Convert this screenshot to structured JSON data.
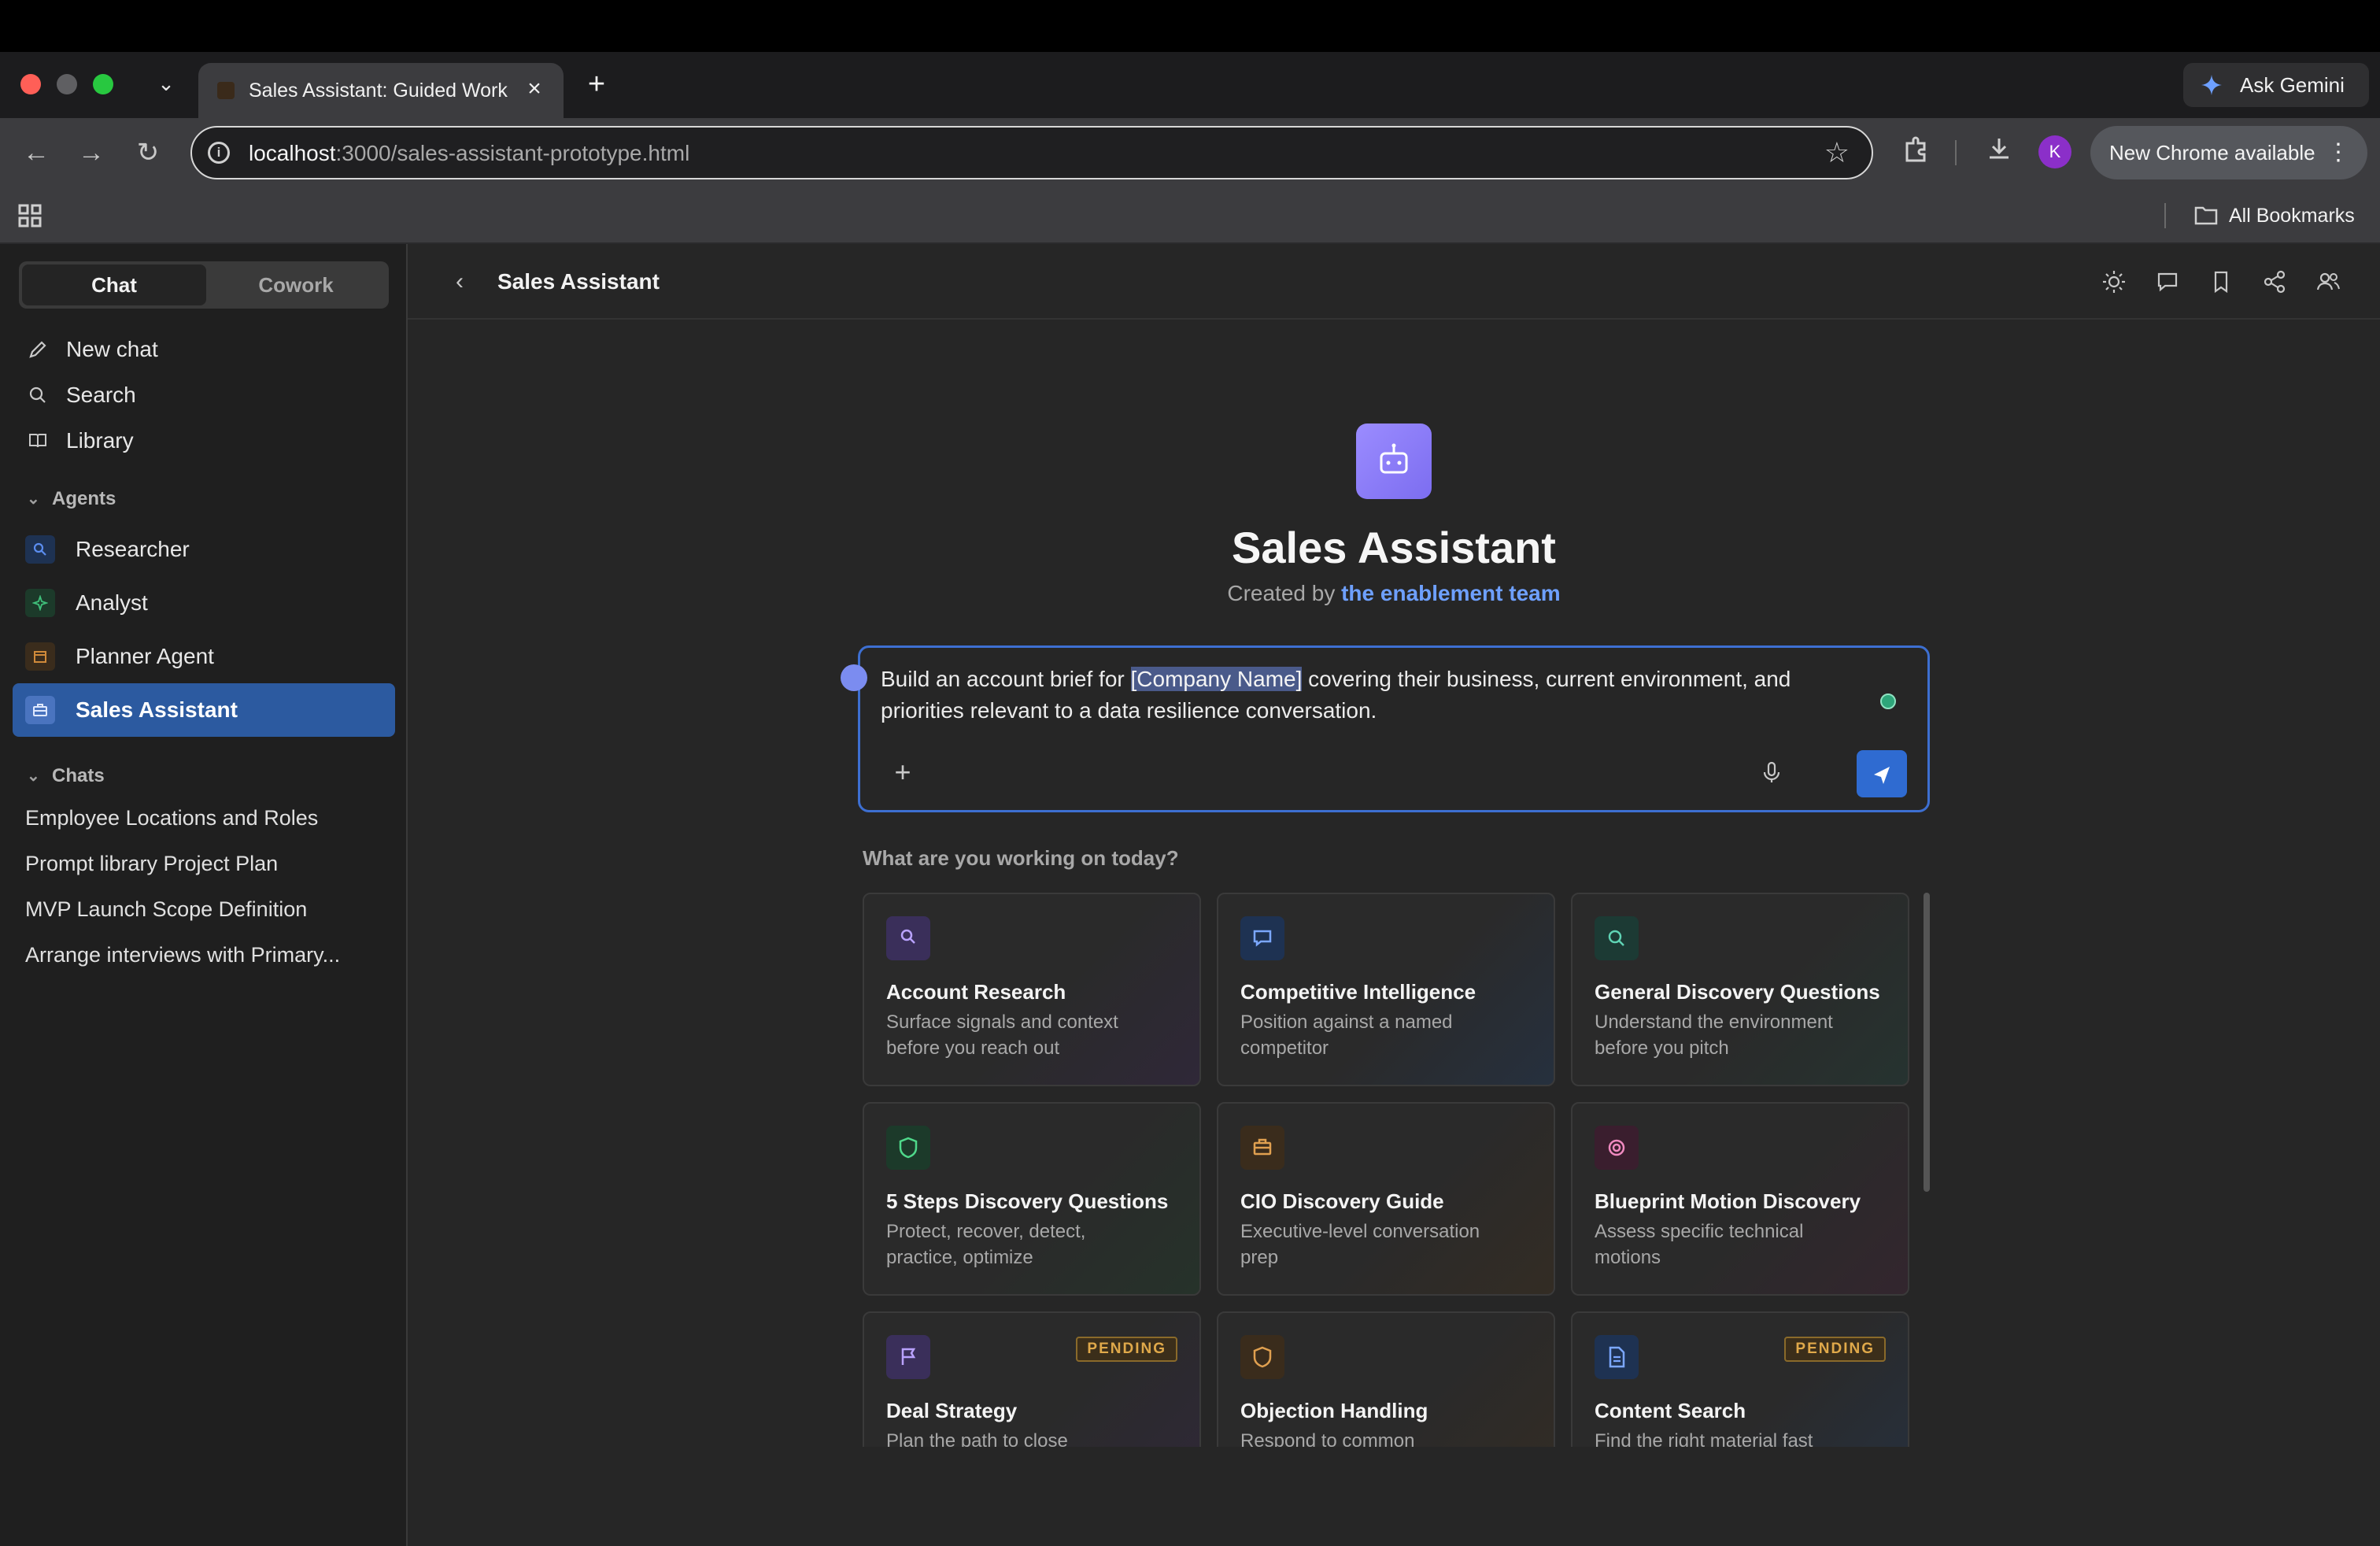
{
  "browser": {
    "tab_title": "Sales Assistant: Guided Work",
    "ask_gemini": "Ask Gemini",
    "url_host": "localhost",
    "url_path": ":3000/sales-assistant-prototype.html",
    "new_chrome": "New Chrome available",
    "profile_initial": "K",
    "all_bookmarks": "All Bookmarks"
  },
  "sidebar": {
    "modes": {
      "chat": "Chat",
      "cowork": "Cowork"
    },
    "nav": {
      "new_chat": "New chat",
      "search": "Search",
      "library": "Library"
    },
    "agents_header": "Agents",
    "agents": [
      {
        "label": "Researcher",
        "icon": "search-icon",
        "color": "#5b8def"
      },
      {
        "label": "Analyst",
        "icon": "sparkle-icon",
        "color": "#3fbf7a"
      },
      {
        "label": "Planner Agent",
        "icon": "calendar-icon",
        "color": "#d08a3a"
      },
      {
        "label": "Sales Assistant",
        "icon": "briefcase-icon",
        "color": "#7ba7ff"
      }
    ],
    "chats_header": "Chats",
    "chats": [
      "Employee Locations and Roles",
      "Prompt library Project Plan",
      "MVP Launch Scope Definition",
      "Arrange interviews with Primary..."
    ]
  },
  "main": {
    "header_title": "Sales Assistant",
    "hero_title": "Sales Assistant",
    "created_by": "Created by",
    "creator": "the enablement team",
    "prompt": {
      "before": "Build an account brief for ",
      "highlight": "[Company Name]",
      "after": " covering their business, current environment, and priorities relevant to a data resilience conversation."
    },
    "working_label": "What are you working on today?",
    "cards": [
      {
        "title": "Account Research",
        "desc": "Surface signals and context before you reach out",
        "icon": "magnifier-icon",
        "color": "#9b7bff",
        "pending": ""
      },
      {
        "title": "Competitive Intelligence",
        "desc": "Position against a named competitor",
        "icon": "chat-icon",
        "color": "#5b8def",
        "pending": ""
      },
      {
        "title": "General Discovery Questions",
        "desc": "Understand the environment before you pitch",
        "icon": "search-icon",
        "color": "#3fbfa0",
        "pending": ""
      },
      {
        "title": "5 Steps Discovery Questions",
        "desc": "Protect, recover, detect, practice, optimize",
        "icon": "shield-icon",
        "color": "#3fbf7a",
        "pending": ""
      },
      {
        "title": "CIO Discovery Guide",
        "desc": "Executive-level conversation prep",
        "icon": "briefcase-icon",
        "color": "#d08a3a",
        "pending": ""
      },
      {
        "title": "Blueprint Motion Discovery",
        "desc": "Assess specific technical motions",
        "icon": "target-icon",
        "color": "#e06aa8",
        "pending": ""
      },
      {
        "title": "Deal Strategy",
        "desc": "Plan the path to close",
        "icon": "flag-icon",
        "color": "#9b7bff",
        "pending": "PENDING"
      },
      {
        "title": "Objection Handling",
        "desc": "Respond to common pushback",
        "icon": "shield-icon",
        "color": "#d08a3a",
        "pending": ""
      },
      {
        "title": "Content Search",
        "desc": "Find the right material fast",
        "icon": "document-icon",
        "color": "#5b8def",
        "pending": "PENDING"
      }
    ]
  }
}
